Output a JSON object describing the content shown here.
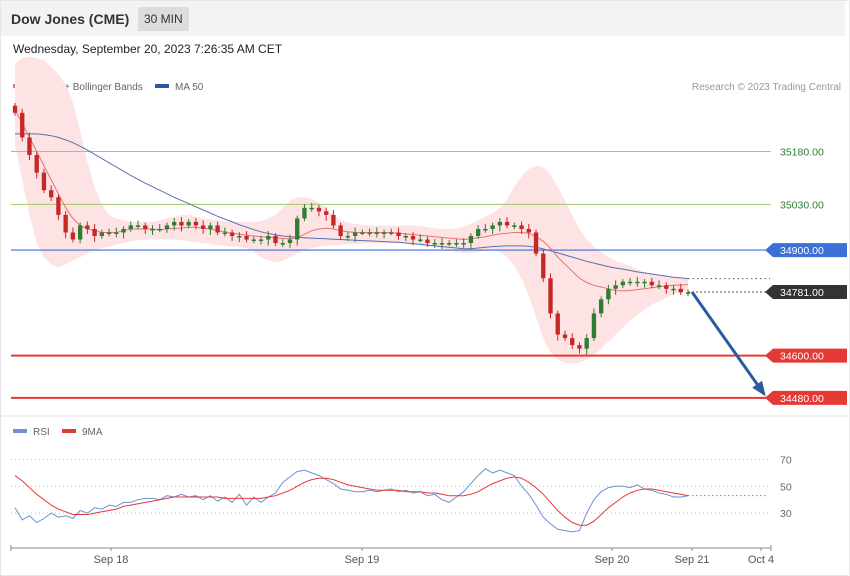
{
  "header": {
    "title": "Dow Jones (CME)",
    "interval": "30 MIN",
    "datetime": "Wednesday, September 20, 2023 7:26:35 AM CET"
  },
  "legend": {
    "ma20_label": "MA 20 + Bollinger Bands",
    "ma50_label": "MA 50",
    "credit": "Research © 2023 Trading Central",
    "rsi_label": "RSI",
    "rsi_ma_label": "9MA"
  },
  "colors": {
    "bull": "#2e7d32",
    "bear": "#c62828",
    "bollinger_fill": "#fde3e3",
    "ma20": "#e57373",
    "ma50": "#5b6fae",
    "resistance": "#9ccc65",
    "pivot": "#3d6fd8",
    "support": "#e53935",
    "current": "#333333",
    "arrow": "#2c5aa0",
    "rsi": "#6d8fd6",
    "rsi_ma": "#e53935"
  },
  "chart_data": [
    {
      "type": "candlestick",
      "title": "",
      "x_ticks": [
        "Sep 18",
        "Sep 19",
        "Sep 20",
        "Sep 21",
        "Oct 4"
      ],
      "ylim": [
        34440,
        35440
      ],
      "levels": [
        {
          "name": "resistance-2",
          "value": 35180.0,
          "label": "35180.00",
          "style": "resistance"
        },
        {
          "name": "resistance-1",
          "value": 35030.0,
          "label": "35030.00",
          "style": "resistance"
        },
        {
          "name": "pivot",
          "value": 34900.0,
          "label": "34900.00",
          "style": "pivot"
        },
        {
          "name": "current",
          "value": 34781.0,
          "label": "34781.00",
          "style": "current"
        },
        {
          "name": "support-1",
          "value": 34600.0,
          "label": "34600.00",
          "style": "support"
        },
        {
          "name": "support-2",
          "value": 34480.0,
          "label": "34480.00",
          "style": "support"
        }
      ],
      "forecast_arrow": {
        "from_value": 34781,
        "to_value": 34480
      },
      "candles_close": [
        35290,
        35220,
        35170,
        35120,
        35070,
        35050,
        35000,
        34950,
        34930,
        34970,
        34960,
        34940,
        34950,
        34950,
        34950,
        34960,
        34970,
        34970,
        34960,
        34960,
        34960,
        34970,
        34980,
        34970,
        34980,
        34970,
        34960,
        34970,
        34950,
        34950,
        34940,
        34940,
        34930,
        34930,
        34930,
        34940,
        34920,
        34920,
        34930,
        34990,
        35020,
        35020,
        35010,
        35000,
        34970,
        34940,
        34940,
        34950,
        34950,
        34950,
        34950,
        34950,
        34950,
        34940,
        34940,
        34930,
        34930,
        34920,
        34920,
        34920,
        34920,
        34920,
        34920,
        34940,
        34960,
        34960,
        34970,
        34980,
        34970,
        34970,
        34960,
        34950,
        34890,
        34820,
        34720,
        34660,
        34650,
        34630,
        34620,
        34650,
        34720,
        34760,
        34790,
        34800,
        34810,
        34810,
        34810,
        34810,
        34800,
        34800,
        34790,
        34790,
        34780,
        34780
      ],
      "ma20": [
        35300,
        35260,
        35220,
        35180,
        35140,
        35100,
        35060,
        35020,
        34990,
        34970,
        34960,
        34955,
        34950,
        34950,
        34950,
        34955,
        34960,
        34960,
        34960,
        34960,
        34958,
        34960,
        34962,
        34962,
        34965,
        34965,
        34962,
        34960,
        34955,
        34952,
        34948,
        34945,
        34942,
        34940,
        34938,
        34937,
        34935,
        34933,
        34932,
        34935,
        34945,
        34955,
        34960,
        34962,
        34960,
        34955,
        34952,
        34950,
        34950,
        34950,
        34950,
        34950,
        34950,
        34948,
        34946,
        34944,
        34942,
        34940,
        34938,
        34936,
        34934,
        34932,
        34930,
        34932,
        34935,
        34938,
        34942,
        34946,
        34948,
        34950,
        34950,
        34948,
        34938,
        34925,
        34905,
        34880,
        34860,
        34840,
        34820,
        34808,
        34800,
        34795,
        34790,
        34785,
        34784,
        34785,
        34788,
        34790,
        34793,
        34796,
        34798,
        34800,
        34801,
        34802
      ],
      "ma50": [
        35230,
        35230,
        35230,
        35230,
        35228,
        35225,
        35220,
        35213,
        35205,
        35195,
        35184,
        35172,
        35160,
        35148,
        35136,
        35124,
        35112,
        35101,
        35090,
        35080,
        35070,
        35060,
        35050,
        35041,
        35032,
        35023,
        35014,
        35005,
        34996,
        34988,
        34980,
        34972,
        34965,
        34958,
        34952,
        34947,
        34943,
        34940,
        34938,
        34936,
        34935,
        34934,
        34933,
        34932,
        34931,
        34930,
        34929,
        34928,
        34927,
        34926,
        34925,
        34924,
        34923,
        34922,
        34920,
        34918,
        34916,
        34914,
        34912,
        34910,
        34908,
        34906,
        34904,
        34904,
        34906,
        34908,
        34910,
        34911,
        34912,
        34912,
        34912,
        34911,
        34908,
        34903,
        34898,
        34892,
        34886,
        34880,
        34874,
        34868,
        34863,
        34858,
        34853,
        34849,
        34846,
        34842,
        34838,
        34835,
        34832,
        34829,
        34826,
        34823,
        34821,
        34819
      ],
      "bb_upper": [
        35430,
        35445,
        35450,
        35445,
        35440,
        35420,
        35400,
        35370,
        35320,
        35240,
        35150,
        35080,
        35030,
        35000,
        34990,
        34985,
        34980,
        34980,
        34980,
        34980,
        34985,
        34990,
        34995,
        35000,
        35000,
        34995,
        34990,
        34988,
        34985,
        34983,
        34980,
        34980,
        34980,
        34980,
        34982,
        34990,
        35000,
        35020,
        35040,
        35050,
        35050,
        35045,
        35035,
        35020,
        35000,
        34985,
        34978,
        34975,
        34972,
        34970,
        34970,
        34970,
        34970,
        34970,
        34970,
        34970,
        34968,
        34965,
        34962,
        34960,
        34960,
        34962,
        34966,
        34975,
        34985,
        34995,
        35005,
        35020,
        35045,
        35080,
        35110,
        35130,
        35140,
        35135,
        35115,
        35080,
        35040,
        35000,
        34960,
        34930,
        34910,
        34895,
        34880,
        34870,
        34862,
        34855,
        34845,
        34838,
        34832,
        34828,
        34825,
        34823,
        34821,
        34820
      ],
      "bb_lower": [
        35200,
        35100,
        35000,
        34920,
        34880,
        34860,
        34850,
        34860,
        34870,
        34880,
        34890,
        34900,
        34905,
        34910,
        34915,
        34920,
        34925,
        34928,
        34930,
        34930,
        34930,
        34930,
        34930,
        34928,
        34925,
        34922,
        34920,
        34918,
        34915,
        34912,
        34910,
        34908,
        34905,
        34895,
        34880,
        34870,
        34865,
        34870,
        34880,
        34890,
        34900,
        34905,
        34910,
        34912,
        34914,
        34915,
        34916,
        34917,
        34918,
        34919,
        34920,
        34920,
        34920,
        34920,
        34920,
        34918,
        34915,
        34912,
        34910,
        34905,
        34900,
        34895,
        34892,
        34892,
        34895,
        34898,
        34900,
        34895,
        34880,
        34855,
        34820,
        34770,
        34710,
        34650,
        34610,
        34590,
        34580,
        34578,
        34580,
        34590,
        34600,
        34620,
        34640,
        34660,
        34680,
        34700,
        34715,
        34730,
        34745,
        34755,
        34765,
        34775,
        34780,
        34785
      ]
    },
    {
      "type": "line",
      "title": "",
      "ylim": [
        10,
        80
      ],
      "y_ticks": [
        70,
        50,
        30
      ],
      "series": [
        {
          "name": "RSI",
          "values": [
            34,
            25,
            28,
            23,
            26,
            30,
            27,
            28,
            26,
            32,
            30,
            34,
            33,
            36,
            35,
            38,
            38,
            40,
            41,
            41,
            40,
            43,
            42,
            44,
            42,
            43,
            40,
            43,
            39,
            42,
            38,
            44,
            36,
            42,
            38,
            42,
            45,
            53,
            57,
            61,
            62,
            60,
            58,
            55,
            52,
            48,
            47,
            46,
            46,
            47,
            46,
            47,
            48,
            46,
            47,
            45,
            46,
            43,
            44,
            40,
            38,
            42,
            46,
            52,
            58,
            63,
            60,
            62,
            60,
            58,
            50,
            44,
            36,
            27,
            22,
            18,
            17,
            16,
            17,
            30,
            40,
            46,
            49,
            50,
            50,
            49,
            51,
            48,
            47,
            45,
            44,
            42,
            42,
            43
          ]
        },
        {
          "name": "9MA",
          "values": [
            58,
            54,
            49,
            44,
            40,
            36,
            33,
            31,
            29,
            29,
            29,
            30,
            31,
            32,
            33,
            35,
            36,
            37,
            38,
            39,
            40,
            41,
            42,
            42,
            42,
            42,
            42,
            42,
            42,
            41,
            41,
            41,
            41,
            41,
            41,
            42,
            43,
            45,
            47,
            50,
            53,
            55,
            56,
            56,
            55,
            53,
            51,
            50,
            49,
            48,
            47,
            47,
            47,
            47,
            46,
            46,
            46,
            45,
            45,
            44,
            43,
            43,
            43,
            44,
            46,
            49,
            52,
            54,
            56,
            57,
            56,
            53,
            49,
            44,
            38,
            32,
            27,
            23,
            21,
            21,
            24,
            29,
            34,
            38,
            42,
            45,
            47,
            48,
            48,
            47,
            46,
            45,
            44,
            43
          ]
        }
      ]
    }
  ]
}
